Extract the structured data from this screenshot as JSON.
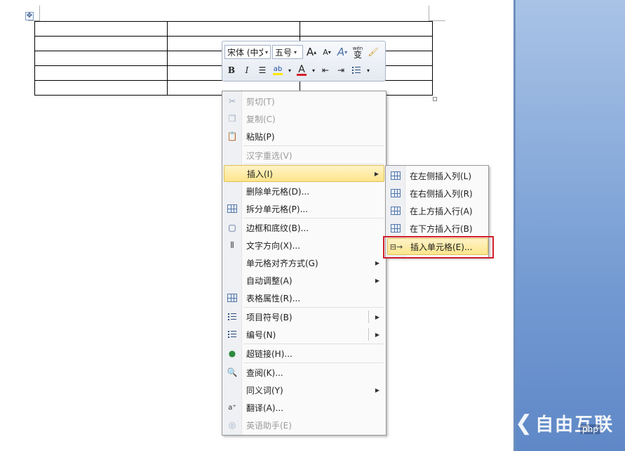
{
  "toolbar": {
    "font_name": "宋体 (中文",
    "font_size": "五号",
    "grow_font": "A",
    "shrink_font": "A",
    "styles": "A",
    "phonetic_top": "wén",
    "phonetic_char": "变",
    "bold": "B",
    "italic": "I",
    "font_color": "A",
    "highlight": "ab"
  },
  "context_menu": {
    "items": [
      {
        "label": "剪切(T)",
        "icon": "scissors-icon",
        "enabled": false
      },
      {
        "label": "复制(C)",
        "icon": "copy-icon",
        "enabled": false
      },
      {
        "label": "粘贴(P)",
        "icon": "paste-icon",
        "enabled": true
      },
      {
        "label": "汉字重选(V)",
        "icon": "",
        "enabled": false
      },
      {
        "label": "插入(I)",
        "icon": "",
        "enabled": true,
        "submenu": true,
        "highlighted": true
      },
      {
        "label": "删除单元格(D)...",
        "icon": "",
        "enabled": true
      },
      {
        "label": "拆分单元格(P)...",
        "icon": "split-cells-icon",
        "enabled": true
      },
      {
        "label": "边框和底纹(B)...",
        "icon": "borders-icon",
        "enabled": true
      },
      {
        "label": "文字方向(X)...",
        "icon": "text-direction-icon",
        "enabled": true
      },
      {
        "label": "单元格对齐方式(G)",
        "icon": "",
        "enabled": true,
        "submenu": true
      },
      {
        "label": "自动调整(A)",
        "icon": "",
        "enabled": true,
        "submenu": true
      },
      {
        "label": "表格属性(R)...",
        "icon": "table-properties-icon",
        "enabled": true
      },
      {
        "label": "项目符号(B)",
        "icon": "bullets-icon",
        "enabled": true,
        "submenu": true
      },
      {
        "label": "编号(N)",
        "icon": "numbering-icon",
        "enabled": true,
        "submenu": true
      },
      {
        "label": "超链接(H)...",
        "icon": "hyperlink-icon",
        "enabled": true
      },
      {
        "label": "查阅(K)...",
        "icon": "lookup-icon",
        "enabled": true
      },
      {
        "label": "同义词(Y)",
        "icon": "",
        "enabled": true,
        "submenu": true
      },
      {
        "label": "翻译(A)...",
        "icon": "translate-icon",
        "enabled": true
      },
      {
        "label": "英语助手(E)",
        "icon": "english-assistant-icon",
        "enabled": false
      }
    ]
  },
  "submenu": {
    "items": [
      {
        "label": "在左侧插入列(L)",
        "icon": "insert-column-left-icon"
      },
      {
        "label": "在右侧插入列(R)",
        "icon": "insert-column-right-icon"
      },
      {
        "label": "在上方插入行(A)",
        "icon": "insert-row-above-icon"
      },
      {
        "label": "在下方插入行(B)",
        "icon": "insert-row-below-icon"
      },
      {
        "label": "插入单元格(E)...",
        "icon": "insert-cells-icon",
        "highlighted": true
      }
    ]
  },
  "watermark": {
    "logo_text": "自由互联",
    "php_tag": "php"
  },
  "colors": {
    "highlight_box": "#d21f2b",
    "menu_highlight": "#fde58c",
    "font_color_bar": "#d21f2b",
    "highlight_bar": "#ffe600"
  }
}
